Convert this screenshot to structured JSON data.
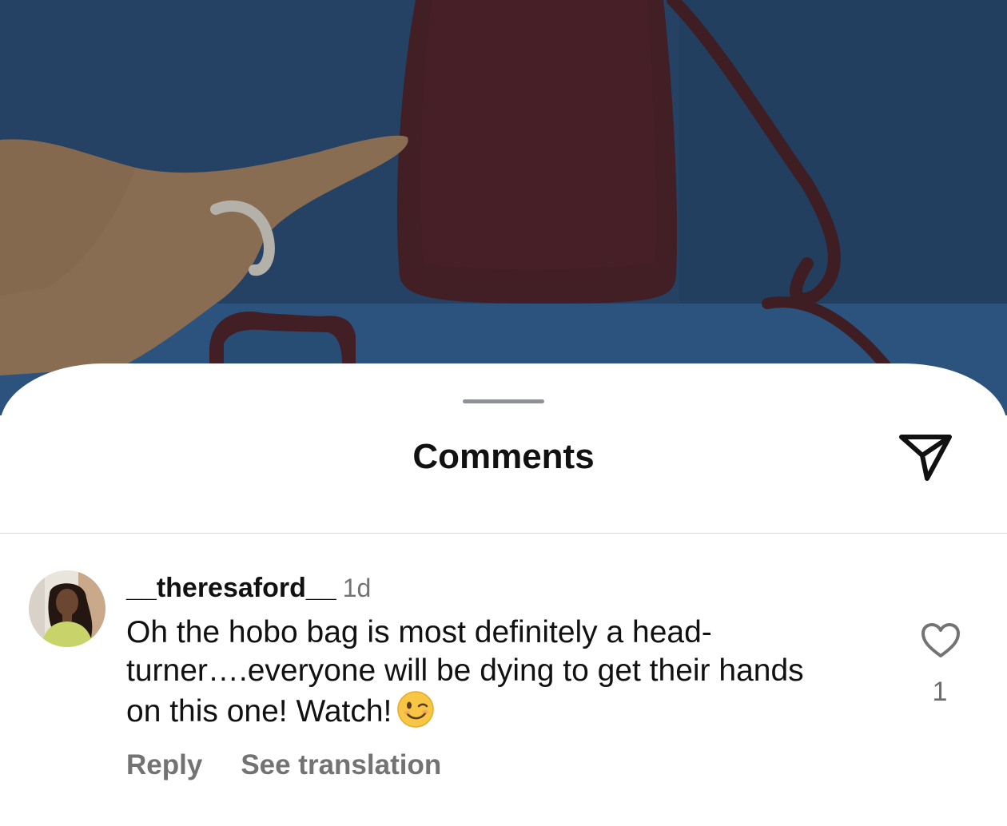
{
  "sheet": {
    "title": "Comments",
    "share_icon": "paper-plane-icon"
  },
  "comment": {
    "username": "__theresaford__",
    "timestamp": "1d",
    "text": "Oh the hobo bag is most definitely a head-turner….everyone will be dying to get their hands on this one! Watch!",
    "emoji": "winking-face-emoji",
    "like_icon": "heart-outline-icon",
    "like_count": "1",
    "reply_label": "Reply",
    "translation_label": "See translation"
  },
  "colors": {
    "video_background": "#2a4b72",
    "sheet_background": "#ffffff",
    "primary_text": "#111111",
    "secondary_text": "#737373",
    "divider": "#dcdcdc"
  }
}
